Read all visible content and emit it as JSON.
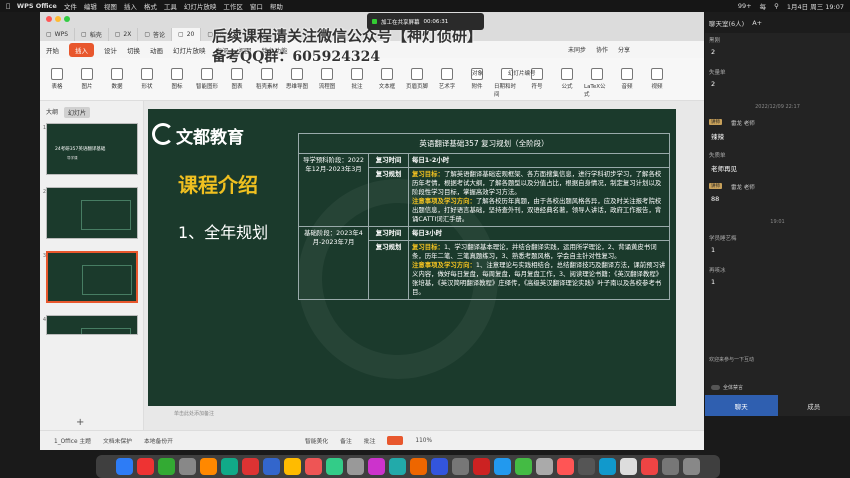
{
  "menubar": {
    "app": "WPS Office",
    "items": [
      "文件",
      "编辑",
      "视图",
      "插入",
      "格式",
      "工具",
      "幻灯片放映",
      "工作区",
      "窗口",
      "帮助"
    ],
    "battery": "99+",
    "date": "1月4日 周三 19:07",
    "net": "每"
  },
  "watermark": {
    "line1": "后续课程请关注微信公众号【神灯侦研】",
    "line2": "备考QQ群：605924324"
  },
  "meeting": {
    "status": "加工在共享屏幕",
    "time": "00:06:31"
  },
  "tabs": [
    {
      "label": "WPS"
    },
    {
      "label": "稻壳"
    },
    {
      "label": "2X"
    },
    {
      "label": "答论"
    },
    {
      "label": "20"
    },
    {
      "label": "2R"
    }
  ],
  "ribbon_tabs": [
    {
      "label": "开始"
    },
    {
      "label": "插入",
      "selected": true
    },
    {
      "label": "设计"
    },
    {
      "label": "切换"
    },
    {
      "label": "动画"
    },
    {
      "label": "幻灯片放映"
    },
    {
      "label": "审阅"
    },
    {
      "label": "视图"
    },
    {
      "label": "特色功能"
    }
  ],
  "ribbon_right": {
    "collab": "未同步",
    "share": "协作",
    "share2": "分享"
  },
  "ribbon": [
    {
      "label": "表格"
    },
    {
      "label": "图片"
    },
    {
      "label": "数据"
    },
    {
      "label": "形状"
    },
    {
      "label": "图标"
    },
    {
      "label": "智能图形"
    },
    {
      "label": "图表"
    },
    {
      "label": "稻壳素材"
    },
    {
      "label": "思维导图"
    },
    {
      "label": "流程图"
    },
    {
      "label": "批注"
    },
    {
      "label": "文本框"
    },
    {
      "label": "页眉页脚"
    },
    {
      "label": "艺术字"
    },
    {
      "label": "附件"
    },
    {
      "label": "日期和时间"
    },
    {
      "label": "符号"
    },
    {
      "label": "公式"
    },
    {
      "label": "LaTeX公式"
    },
    {
      "label": "音频"
    },
    {
      "label": "视频"
    }
  ],
  "ribbon_extra": {
    "object": "对象",
    "slide_no": "幻灯片编号"
  },
  "panel_tabs": [
    {
      "label": "大纲"
    },
    {
      "label": "幻灯片",
      "selected": true
    }
  ],
  "thumbs": [
    {
      "num": "1",
      "title": "24考研357英语翻译基础",
      "sub": "导学课"
    },
    {
      "num": "2"
    },
    {
      "num": "3"
    },
    {
      "num": "4"
    }
  ],
  "slide": {
    "logo": "文都教育",
    "title": "课程介绍",
    "subtitle": "1、全年规划",
    "table": {
      "caption": "英语翻译基础357 复习规划（全阶段）",
      "rows": [
        {
          "stage": "导学预科阶段：2022年12月-2023年3月",
          "key": "复习时间",
          "val": "每日1-2小时"
        },
        {
          "key": "复习规划",
          "goal_label": "复习目标：",
          "goal": "了解英语翻译基础宏观框架、各方面搜集信息，进行学科初步学习，了解各校历年考情，根据考试大纲，了解各题型以及分值占比，根据自身情况，制定复习计划以及阶段性学习目标，掌握高效学习方法。",
          "note_label": "注意事项及学习方向：",
          "note": "了解各校历年真题，由于各校出题风格各异，应及时关注报考院校出题信息，打好语言基础，坚持查外刊，双语经典名著，领导人讲话，政府工作报告，背诵CATTI词汇手册。"
        },
        {
          "stage": "基础阶段：2023年4月-2023年7月",
          "key": "复习时间",
          "val": "每日3小时"
        },
        {
          "key": "复习规划",
          "goal_label": "复习目标：",
          "goal": "1、学习翻译基本理论，并结合翻译实践，运用所学理论，2、背诵黄皮书词条，历年二笔、三笔真题练习，3、熟悉考题风格，学会自主针对性复习。",
          "note_label": "注意事项及学习方向：",
          "note": "1、注意理论与实践相结合，总结翻译技巧及翻译方法，课前预习讲义内容，做好每日复盘，每周复盘，每月复盘工作，3、阅读理论书籍：《英汉翻译教程》张培基，《英汉简明翻译教程》庄绎传，《高级英汉翻译理论实践》叶子南以及各校参考书目。"
        }
      ]
    }
  },
  "statusbar": {
    "slide": "1_Office 主题",
    "protect": "文档未保护",
    "backup": "本地备份开",
    "beautify": "智能美化",
    "notes": "备注",
    "comment": "批注",
    "zoom": "110%",
    "click_hint": "单击此处添加备注"
  },
  "chat": {
    "header": "聊天室(6人)",
    "header_icon": "A+",
    "entries": [
      {
        "type": "name",
        "text": "黑刚"
      },
      {
        "type": "val",
        "text": "2"
      },
      {
        "type": "name",
        "text": "失量单"
      },
      {
        "type": "val",
        "text": "2"
      },
      {
        "type": "time",
        "text": "2022/12/09 22:17"
      },
      {
        "type": "badge",
        "badge": "讲师",
        "text": "雷龙 老师"
      },
      {
        "type": "val",
        "text": "辣辣"
      },
      {
        "type": "name",
        "text": "失质单"
      },
      {
        "type": "val",
        "text": "老师再见"
      },
      {
        "type": "badge",
        "badge": "讲师",
        "text": "雷龙 老师"
      },
      {
        "type": "val",
        "text": "88"
      },
      {
        "type": "time",
        "text": "19:01"
      },
      {
        "type": "name",
        "text": "学员睡艺梅"
      },
      {
        "type": "val",
        "text": "1"
      },
      {
        "type": "name",
        "text": "再咳冰"
      },
      {
        "type": "val",
        "text": "1"
      }
    ],
    "join_hint": "欢迎来参与一下互动",
    "mute": "全体禁言",
    "tab_chat": "聊天",
    "tab_members": "成员"
  },
  "colors": {
    "accent": "#e8572d",
    "slide_bg": "#1b3a2c",
    "title_yellow": "#f0c020",
    "chat_tab": "#2f5fb0"
  }
}
